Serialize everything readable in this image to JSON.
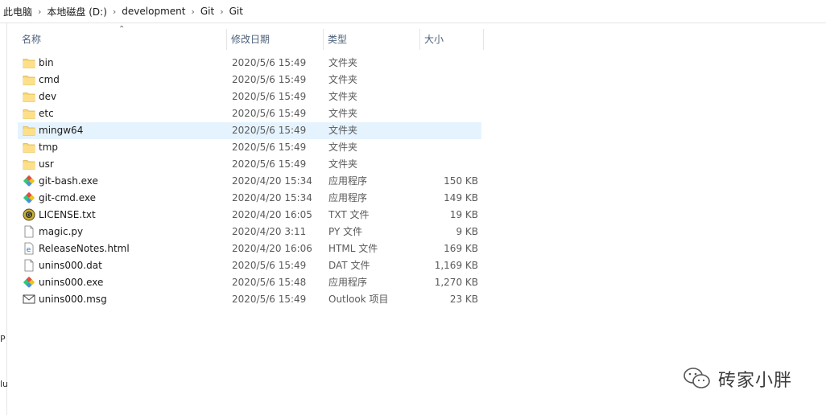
{
  "breadcrumb": [
    "此电脑",
    "本地磁盘 (D:)",
    "development",
    "Git",
    "Git"
  ],
  "left_pane": {
    "fragment_p": "P",
    "fragment_lu": "lu"
  },
  "columns": {
    "name": "名称",
    "date": "修改日期",
    "type": "类型",
    "size": "大小"
  },
  "files": [
    {
      "icon": "folder-icon",
      "name": "bin",
      "date": "2020/5/6 15:49",
      "type": "文件夹",
      "size": ""
    },
    {
      "icon": "folder-icon",
      "name": "cmd",
      "date": "2020/5/6 15:49",
      "type": "文件夹",
      "size": ""
    },
    {
      "icon": "folder-icon",
      "name": "dev",
      "date": "2020/5/6 15:49",
      "type": "文件夹",
      "size": ""
    },
    {
      "icon": "folder-icon",
      "name": "etc",
      "date": "2020/5/6 15:49",
      "type": "文件夹",
      "size": ""
    },
    {
      "icon": "folder-icon",
      "name": "mingw64",
      "date": "2020/5/6 15:49",
      "type": "文件夹",
      "size": "",
      "selected": true
    },
    {
      "icon": "folder-icon",
      "name": "tmp",
      "date": "2020/5/6 15:49",
      "type": "文件夹",
      "size": ""
    },
    {
      "icon": "folder-icon",
      "name": "usr",
      "date": "2020/5/6 15:49",
      "type": "文件夹",
      "size": ""
    },
    {
      "icon": "git-icon",
      "name": "git-bash.exe",
      "date": "2020/4/20 15:34",
      "type": "应用程序",
      "size": "150 KB"
    },
    {
      "icon": "git-icon",
      "name": "git-cmd.exe",
      "date": "2020/4/20 15:34",
      "type": "应用程序",
      "size": "149 KB"
    },
    {
      "icon": "license-icon",
      "name": "LICENSE.txt",
      "date": "2020/4/20 16:05",
      "type": "TXT 文件",
      "size": "19 KB"
    },
    {
      "icon": "document-icon",
      "name": "magic.py",
      "date": "2020/4/20 3:11",
      "type": "PY 文件",
      "size": "9 KB"
    },
    {
      "icon": "html-file-icon",
      "name": "ReleaseNotes.html",
      "date": "2020/4/20 16:06",
      "type": "HTML 文件",
      "size": "169 KB"
    },
    {
      "icon": "document-icon",
      "name": "unins000.dat",
      "date": "2020/5/6 15:49",
      "type": "DAT 文件",
      "size": "1,169 KB"
    },
    {
      "icon": "git-icon",
      "name": "unins000.exe",
      "date": "2020/5/6 15:48",
      "type": "应用程序",
      "size": "1,270 KB"
    },
    {
      "icon": "mail-icon",
      "name": "unins000.msg",
      "date": "2020/5/6 15:49",
      "type": "Outlook 项目",
      "size": "23 KB"
    }
  ],
  "watermark": {
    "text": "砖家小胖"
  }
}
